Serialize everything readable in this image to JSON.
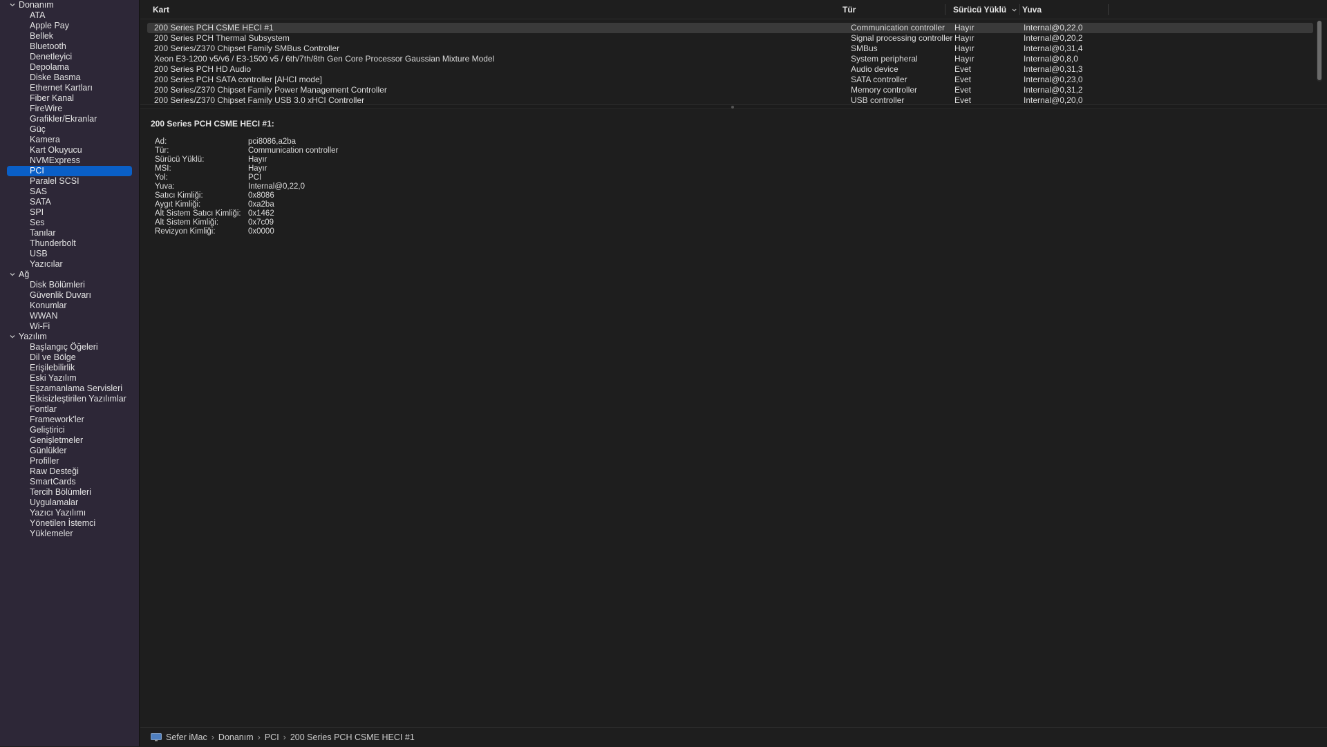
{
  "sidebar": {
    "groups": [
      {
        "label": "Donanım",
        "items": [
          "ATA",
          "Apple Pay",
          "Bellek",
          "Bluetooth",
          "Denetleyici",
          "Depolama",
          "Diske Basma",
          "Ethernet Kartları",
          "Fiber Kanal",
          "FireWire",
          "Grafikler/Ekranlar",
          "Güç",
          "Kamera",
          "Kart Okuyucu",
          "NVMExpress",
          "PCI",
          "Paralel SCSI",
          "SAS",
          "SATA",
          "SPI",
          "Ses",
          "Tanılar",
          "Thunderbolt",
          "USB",
          "Yazıcılar"
        ]
      },
      {
        "label": "Ağ",
        "items": [
          "Disk Bölümleri",
          "Güvenlik Duvarı",
          "Konumlar",
          "WWAN",
          "Wi-Fi"
        ]
      },
      {
        "label": "Yazılım",
        "items": [
          "Başlangıç Öğeleri",
          "Dil ve Bölge",
          "Erişilebilirlik",
          "Eski Yazılım",
          "Eşzamanlama Servisleri",
          "Etkisizleştirilen Yazılımlar",
          "Fontlar",
          "Framework'ler",
          "Geliştirici",
          "Genişletmeler",
          "Günlükler",
          "Profiller",
          "Raw Desteği",
          "SmartCards",
          "Tercih Bölümleri",
          "Uygulamalar",
          "Yazıcı Yazılımı",
          "Yönetilen İstemci",
          "Yüklemeler"
        ]
      }
    ],
    "selected": "PCI"
  },
  "table": {
    "columns": [
      "Kart",
      "Tür",
      "Sürücü Yüklü",
      "Yuva"
    ],
    "rows": [
      [
        "200 Series PCH CSME HECI #1",
        "Communication controller",
        "Hayır",
        "Internal@0,22,0"
      ],
      [
        "200 Series PCH Thermal Subsystem",
        "Signal processing controller",
        "Hayır",
        "Internal@0,20,2"
      ],
      [
        "200 Series/Z370 Chipset Family SMBus Controller",
        "SMBus",
        "Hayır",
        "Internal@0,31,4"
      ],
      [
        "Xeon E3-1200 v5/v6 / E3-1500 v5 / 6th/7th/8th Gen Core Processor Gaussian Mixture Model",
        "System peripheral",
        "Hayır",
        "Internal@0,8,0"
      ],
      [
        "200 Series PCH HD Audio",
        "Audio device",
        "Evet",
        "Internal@0,31,3"
      ],
      [
        "200 Series PCH SATA controller [AHCI mode]",
        "SATA controller",
        "Evet",
        "Internal@0,23,0"
      ],
      [
        "200 Series/Z370 Chipset Family Power Management Controller",
        "Memory controller",
        "Evet",
        "Internal@0,31,2"
      ],
      [
        "200 Series/Z370 Chipset Family USB 3.0 xHCI Controller",
        "USB controller",
        "Evet",
        "Internal@0,20,0"
      ]
    ]
  },
  "detail": {
    "title": "200 Series PCH CSME HECI #1:",
    "fields": [
      [
        "Ad:",
        "pci8086,a2ba"
      ],
      [
        "Tür:",
        "Communication controller"
      ],
      [
        "Sürücü Yüklü:",
        "Hayır"
      ],
      [
        "MSI:",
        "Hayır"
      ],
      [
        "Yol:",
        "PCI"
      ],
      [
        "Yuva:",
        "Internal@0,22,0"
      ],
      [
        "Satıcı Kimliği:",
        "0x8086"
      ],
      [
        "Aygıt Kimliği:",
        "0xa2ba"
      ],
      [
        "Alt Sistem Satıcı Kimliği:",
        "0x1462"
      ],
      [
        "Alt Sistem Kimliği:",
        "0x7c09"
      ],
      [
        "Revizyon Kimliği:",
        "0x0000"
      ]
    ]
  },
  "pathbar": {
    "crumbs": [
      "Sefer iMac",
      "Donanım",
      "PCI",
      "200 Series PCH CSME HECI #1"
    ],
    "separator": "›"
  },
  "colors": {
    "sidebar_bg": "#2d2737",
    "selection": "#0a5fc7",
    "main_bg": "#1e1e1e"
  }
}
